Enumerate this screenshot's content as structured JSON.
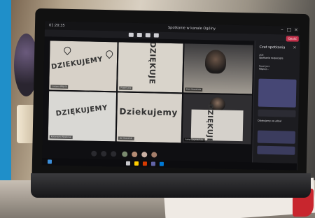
{
  "scene": {
    "screen_title": "Spotkanie w kanale Ogólny",
    "screen_time": "01:20:35"
  },
  "meeting": {
    "leave_label": "Opuść",
    "tiles": [
      {
        "sign": "DZIEKUJEMY",
        "label": "Lucyna Wójcik"
      },
      {
        "sign": "DZIĘKUJE",
        "label": "Paweł Jarz"
      },
      {
        "sign": "",
        "label": "Ewa Kowalska"
      },
      {
        "sign": "DZIĘKUJEMY",
        "label": "Katarzyna Nowicka"
      },
      {
        "sign": "Dziekujemy",
        "label": "Jan Kowalski"
      },
      {
        "sign": "DZIĘKUJE",
        "label": "Anna Szymańska"
      }
    ]
  },
  "chat": {
    "title": "Czat spotkania",
    "messages": [
      {
        "who": "ZOE",
        "text": "Spotkanie rozpoczęte"
      },
      {
        "who": "Paweł Jarz",
        "text": "https://..."
      },
      {
        "who": "",
        "text": "Dziękujemy za udział"
      }
    ],
    "input_placeholder": "Wpisz nową wiadomość"
  }
}
